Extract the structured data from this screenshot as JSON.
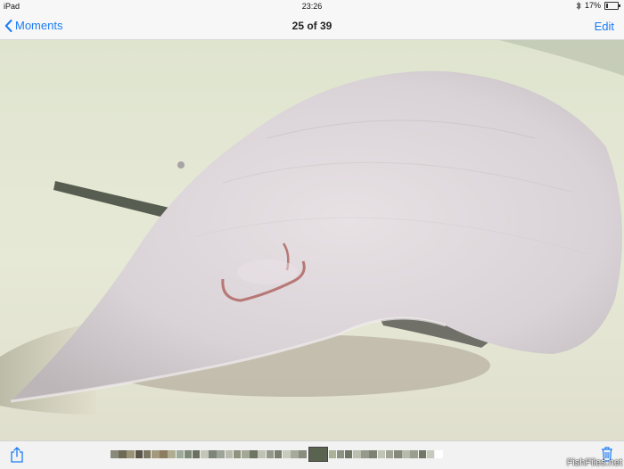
{
  "status_bar": {
    "device": "iPad",
    "time": "23:26",
    "battery_percent": "17%",
    "battery_level": 0.17,
    "bluetooth_icon": "bluetooth-icon"
  },
  "nav_bar": {
    "back_label": "Moments",
    "title": "25 of 39",
    "edit_label": "Edit"
  },
  "photo": {
    "subject": "stingray-photo"
  },
  "toolbar": {
    "share_icon": "share-icon",
    "trash_icon": "trash-icon",
    "selected_index": 25,
    "total": 39,
    "thumb_colors": [
      "#8a8a7a",
      "#6f6a55",
      "#9a9378",
      "#5a5548",
      "#7c7762",
      "#a39a80",
      "#8c7c60",
      "#b0ad92",
      "#9fa99a",
      "#7f8a78",
      "#6a725f",
      "#c4c7b8",
      "#7d847a",
      "#9ea49a",
      "#b9bcad",
      "#8f937f",
      "#a4a896",
      "#6e7462",
      "#bfc3b3",
      "#93988a",
      "#7a7e70",
      "#c8ccbd",
      "#a6aa9b",
      "#898d7e",
      "#b2b6a8",
      "#a9b196",
      "#8c9282",
      "#6f7565",
      "#bbbfb0",
      "#959a8b",
      "#7e8273",
      "#c1c5b6",
      "#a0a495",
      "#858979",
      "#b6baab",
      "#9a9e8f",
      "#727667",
      "#c6cabb",
      "#ffffff"
    ]
  },
  "watermark": "FishFiles.net"
}
